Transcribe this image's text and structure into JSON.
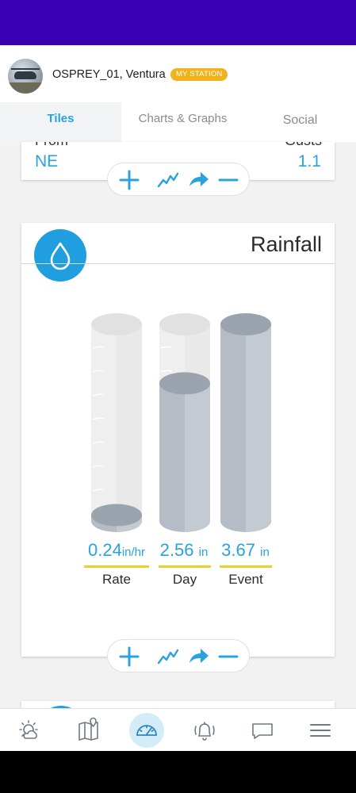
{
  "station": {
    "name": "OSPREY_01, Ventura",
    "badge": "MY STATION"
  },
  "tabs": [
    "Tiles",
    "Charts & Graphs",
    "Social"
  ],
  "active_tab": "Tiles",
  "wind_card": {
    "from_label": "From",
    "gusts_label": "Gusts",
    "direction": "NE",
    "gust_value": "1.1"
  },
  "rain_card": {
    "title": "Rainfall",
    "icon": "water-drop-icon",
    "gauges": [
      {
        "value": "0.24",
        "unit": "in/hr",
        "label": "Rate",
        "fill_fraction": 0.03
      },
      {
        "value": "2.56",
        "unit": "in",
        "label": "Day",
        "fill_fraction": 0.7
      },
      {
        "value": "3.67",
        "unit": "in",
        "label": "Event",
        "fill_fraction": 1.0
      }
    ]
  },
  "actions": [
    "plus-icon",
    "chart-line-icon",
    "share-icon",
    "minus-icon"
  ],
  "bottom_nav": [
    "weather-icon",
    "map-icon",
    "dashboard-icon",
    "alerts-icon",
    "chat-icon",
    "menu-icon"
  ],
  "colors": {
    "status_bar": "#3b00b3",
    "accent": "#29a3dd",
    "icon_blue": "#1f9ee0",
    "badge": "#f2b21b",
    "underline": "#f0cf2c"
  }
}
